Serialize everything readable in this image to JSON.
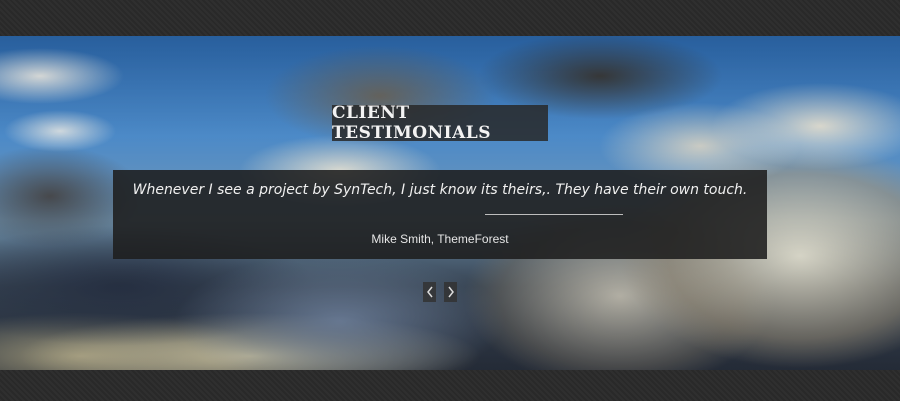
{
  "section": {
    "title": "CLIENT TESTIMONIALS"
  },
  "testimonial": {
    "quote": "Whenever I see a project by SynTech, I just know its theirs,. They have their own touch.",
    "author": "Mike Smith, ThemeForest"
  },
  "slider": {
    "prev_icon": "chevron-left-icon",
    "next_icon": "chevron-right-icon"
  },
  "colors": {
    "page_background": "#2b2b2b",
    "overlay": "#1e1e1e",
    "text": "#f0f0f0"
  }
}
